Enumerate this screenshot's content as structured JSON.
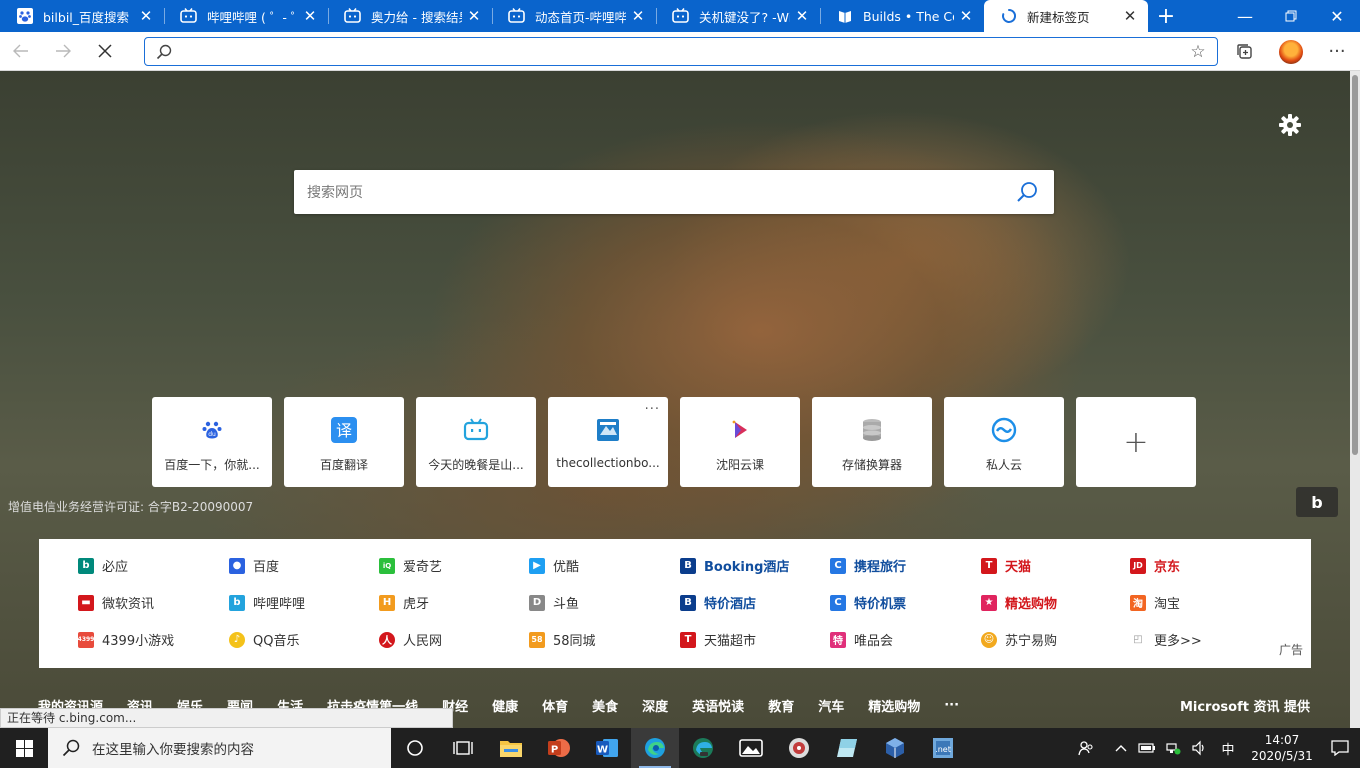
{
  "tabs": [
    {
      "title": "bilbil_百度搜索",
      "icon": "baidu-icon",
      "active": false
    },
    {
      "title": "哔哩哔哩 ( ゜- ゜)つ",
      "icon": "bilibili-icon",
      "active": false
    },
    {
      "title": "奥力给 - 搜索结果",
      "icon": "bilibili-icon",
      "active": false
    },
    {
      "title": "动态首页-哔哩哔哩",
      "icon": "bilibili-icon",
      "active": false
    },
    {
      "title": "关机键没了? -Win",
      "icon": "bilibili-icon",
      "active": false
    },
    {
      "title": "Builds • The Collec",
      "icon": "book-icon",
      "active": false
    },
    {
      "title": "新建标签页",
      "icon": "loading-icon",
      "active": true
    }
  ],
  "toolbar": {
    "address_value": ""
  },
  "search": {
    "placeholder": "搜索网页"
  },
  "tiles": [
    {
      "label": "百度一下，你就...",
      "icon": "baidu-paw-icon",
      "color": "#2b62e0"
    },
    {
      "label": "百度翻译",
      "icon": "translate-icon",
      "color": "#2b8ff0"
    },
    {
      "label": "今天的晚餐是山...",
      "icon": "bilibili-tv-icon",
      "color": "#23a3dd"
    },
    {
      "label": "thecollectionbo...",
      "icon": "collection-icon",
      "color": "#1e7ec8"
    },
    {
      "label": "沈阳云课",
      "icon": "play-icon",
      "color": "#d82f5a"
    },
    {
      "label": "存储换算器",
      "icon": "database-icon",
      "color": "#8c8c8c"
    },
    {
      "label": "私人云",
      "icon": "cloud-icon",
      "color": "#1d8fe8"
    }
  ],
  "license": "增值电信业务经营许可证: 合字B2-20090007",
  "sites": [
    [
      {
        "label": "必应",
        "icon": "bing-icon",
        "color": "#00897b",
        "style": "normal"
      },
      {
        "label": "百度",
        "icon": "baidu-icon",
        "color": "#2b62e0",
        "style": "normal"
      },
      {
        "label": "爱奇艺",
        "icon": "iqiyi-icon",
        "color": "#2bbf3c",
        "style": "normal"
      },
      {
        "label": "优酷",
        "icon": "youku-icon",
        "color": "#1e9ff2",
        "style": "normal"
      },
      {
        "label": "Booking酒店",
        "icon": "booking-icon",
        "color": "#0b3d8c",
        "style": "blue"
      },
      {
        "label": "携程旅行",
        "icon": "ctrip-icon",
        "color": "#2577e3",
        "style": "blue"
      },
      {
        "label": "天猫",
        "icon": "tmall-icon",
        "color": "#d3171c",
        "style": "red"
      },
      {
        "label": "京东",
        "icon": "jd-icon",
        "color": "#d3171c",
        "style": "red"
      }
    ],
    [
      {
        "label": "微软资讯",
        "icon": "msn-icon",
        "color": "#d3171c",
        "style": "normal"
      },
      {
        "label": "哔哩哔哩",
        "icon": "bilibili-icon",
        "color": "#23a3dd",
        "style": "normal"
      },
      {
        "label": "虎牙",
        "icon": "huya-icon",
        "color": "#f29b1e",
        "style": "normal"
      },
      {
        "label": "斗鱼",
        "icon": "douyu-icon",
        "color": "#888888",
        "style": "normal"
      },
      {
        "label": "特价酒店",
        "icon": "booking-icon",
        "color": "#0b3d8c",
        "style": "blue"
      },
      {
        "label": "特价机票",
        "icon": "ctrip-icon",
        "color": "#2577e3",
        "style": "blue"
      },
      {
        "label": "精选购物",
        "icon": "shopping-icon",
        "color": "#e0245e",
        "style": "red"
      },
      {
        "label": "淘宝",
        "icon": "taobao-icon",
        "color": "#f26522",
        "style": "normal"
      }
    ],
    [
      {
        "label": "4399小游戏",
        "icon": "4399-icon",
        "color": "#e84b3c",
        "style": "normal"
      },
      {
        "label": "QQ音乐",
        "icon": "qqmusic-icon",
        "color": "#f4c21a",
        "style": "normal"
      },
      {
        "label": "人民网",
        "icon": "people-icon",
        "color": "#d3171c",
        "style": "normal"
      },
      {
        "label": "58同城",
        "icon": "58-icon",
        "color": "#f29b1e",
        "style": "normal"
      },
      {
        "label": "天猫超市",
        "icon": "tmall-market-icon",
        "color": "#d3171c",
        "style": "normal"
      },
      {
        "label": "唯品会",
        "icon": "vip-icon",
        "color": "#e0307a",
        "style": "normal"
      },
      {
        "label": "苏宁易购",
        "icon": "suning-icon",
        "color": "#f2a91e",
        "style": "normal"
      },
      {
        "label": "更多>>",
        "icon": "more-icon",
        "color": "#999999",
        "style": "normal"
      }
    ]
  ],
  "ad_label": "广告",
  "newsbar": {
    "items": [
      "我的资讯源",
      "资讯",
      "娱乐",
      "要闻",
      "生活",
      "抗击疫情第一线",
      "财经",
      "健康",
      "体育",
      "美食",
      "深度",
      "英语悦读",
      "教育",
      "汽车",
      "精选购物",
      "···"
    ],
    "provider": "Microsoft 资讯 提供"
  },
  "status": "正在等待 c.bing.com...",
  "taskbar": {
    "search_placeholder": "在这里输入你要搜索的内容",
    "ime": "中",
    "time": "14:07",
    "date": "2020/5/31"
  }
}
